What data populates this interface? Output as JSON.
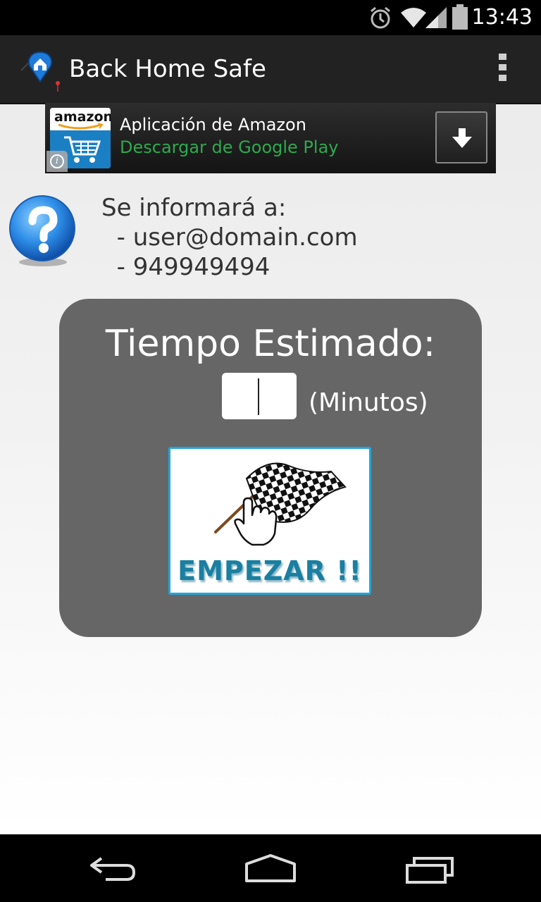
{
  "status_bar": {
    "time": "13:43"
  },
  "action_bar": {
    "title": "Back Home Safe"
  },
  "ad": {
    "brand": "amazon",
    "title": "Aplicación de Amazon",
    "subtitle": "Descargar de Google Play"
  },
  "info": {
    "heading": "Se informará a:",
    "recipients": [
      "  - user@domain.com",
      "  - 949949494"
    ]
  },
  "card": {
    "title": "Tiempo Estimado:",
    "minutes_value": "",
    "minutes_label": "(Minutos)",
    "start_label": "EMPEZAR !!"
  },
  "colors": {
    "card_bg": "#666666",
    "ad_subtitle": "#2eaa4e",
    "start_border": "#21a6d9",
    "start_text": "#1a7fa0"
  }
}
